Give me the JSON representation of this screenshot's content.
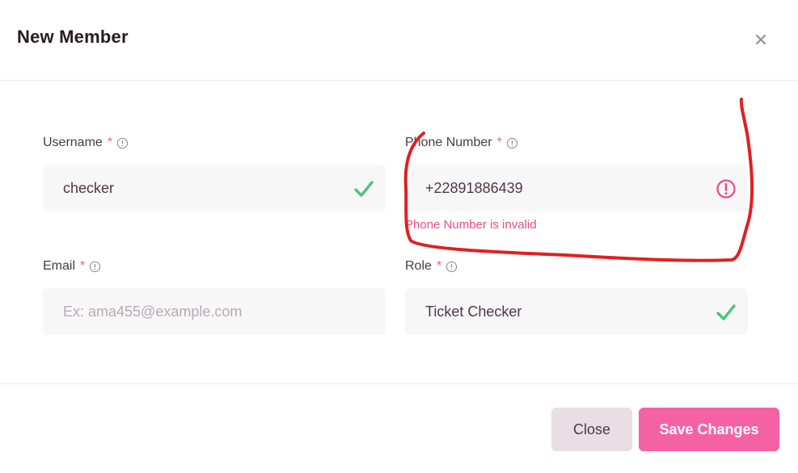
{
  "modal": {
    "title": "New Member",
    "close_icon": "close-icon"
  },
  "fields": {
    "username": {
      "label": "Username",
      "required": "*",
      "value": "checker",
      "status": "valid"
    },
    "phone": {
      "label": "Phone Number",
      "required": "*",
      "value": "+22891886439",
      "status": "invalid",
      "error": "Phone Number is invalid"
    },
    "email": {
      "label": "Email",
      "required": "*",
      "value": "",
      "placeholder": "Ex: ama455@example.com"
    },
    "role": {
      "label": "Role",
      "required": "*",
      "value": "Ticket Checker",
      "status": "valid"
    }
  },
  "footer": {
    "close_label": "Close",
    "save_label": "Save Changes"
  },
  "colors": {
    "accent": "#f562a4",
    "required": "#f05a9b",
    "error": "#ec4a86",
    "valid": "#4cc47c",
    "annotation": "#e02020"
  }
}
